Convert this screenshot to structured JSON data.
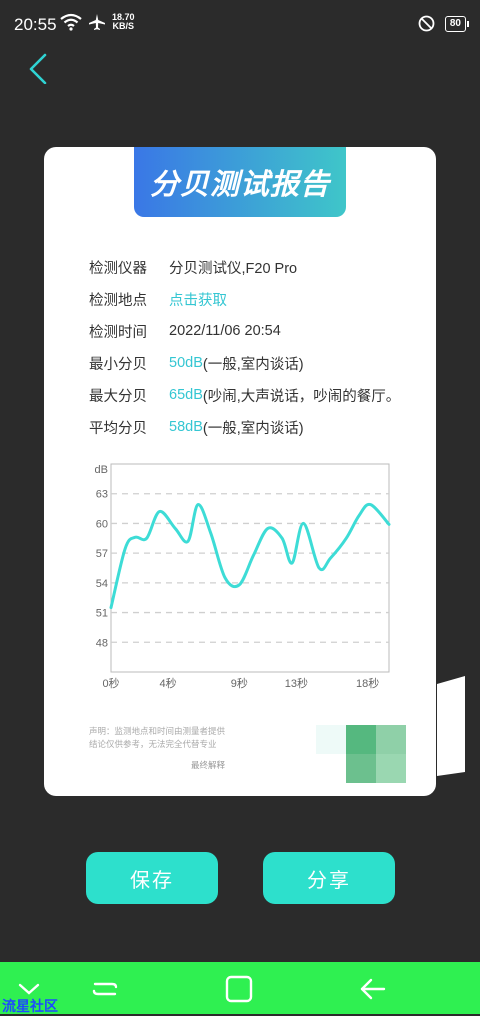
{
  "status_bar": {
    "time": "20:55",
    "net_speed_value": "18.70",
    "net_speed_unit": "KB/S",
    "battery": "80"
  },
  "report": {
    "title": "分贝测试报告",
    "rows": [
      {
        "label": "检测仪器",
        "value": "分贝测试仪,F20 Pro",
        "accent": "",
        "suffix": ""
      },
      {
        "label": "检测地点",
        "value": "",
        "accent": "点击获取",
        "suffix": ""
      },
      {
        "label": "检测时间",
        "value": "2022/11/06 20:54",
        "accent": "",
        "suffix": ""
      },
      {
        "label": "最小分贝",
        "value": "",
        "accent": "50dB",
        "suffix": " (一般,室内谈话)"
      },
      {
        "label": "最大分贝",
        "value": "",
        "accent": "65dB",
        "suffix": " (吵闹,大声说话，吵闹的餐厅。"
      },
      {
        "label": "平均分贝",
        "value": "",
        "accent": "58dB",
        "suffix": " (一般,室内谈话)"
      }
    ],
    "disclaimer_line1": "声明：监测地点和时间由测量者提供",
    "disclaimer_line2": "结论仅供参考，无法完全代替专业",
    "final_note": "最终解释"
  },
  "chart_data": {
    "type": "line",
    "ylabel": "dB",
    "y_ticks": [
      48,
      51,
      54,
      57,
      60,
      63
    ],
    "ylim": [
      45,
      66
    ],
    "x_tick_labels": [
      "0秒",
      "4秒",
      "9秒",
      "13秒",
      "18秒"
    ],
    "x_tick_values": [
      0,
      4,
      9,
      13,
      18
    ],
    "xlim": [
      0,
      19.5
    ],
    "grid": true,
    "line_color": "#3ddcd6",
    "series": [
      {
        "x": [
          0,
          1,
          1.7,
          2.5,
          3.4,
          4.5,
          5.4,
          6.1,
          7,
          8,
          9,
          10,
          11,
          12,
          12.7,
          13.5,
          14.6,
          15.4,
          16.5,
          17.4,
          18.2,
          19.5
        ],
        "values": [
          51.5,
          57.5,
          58.6,
          58.5,
          61.2,
          59.5,
          58.2,
          61.9,
          59,
          54.5,
          53.8,
          56.8,
          59.5,
          58.5,
          56,
          60,
          55.5,
          56.5,
          58.5,
          60.8,
          61.9,
          59.9
        ]
      }
    ]
  },
  "buttons": {
    "save": "保存",
    "share": "分享"
  },
  "watermark": "流星社区",
  "colors": {
    "background": "#2b2b2b",
    "accent": "#34c6d2",
    "button": "#2de0cc",
    "nav_bar": "#2ff051",
    "back_arrow": "#2fd3d3"
  }
}
